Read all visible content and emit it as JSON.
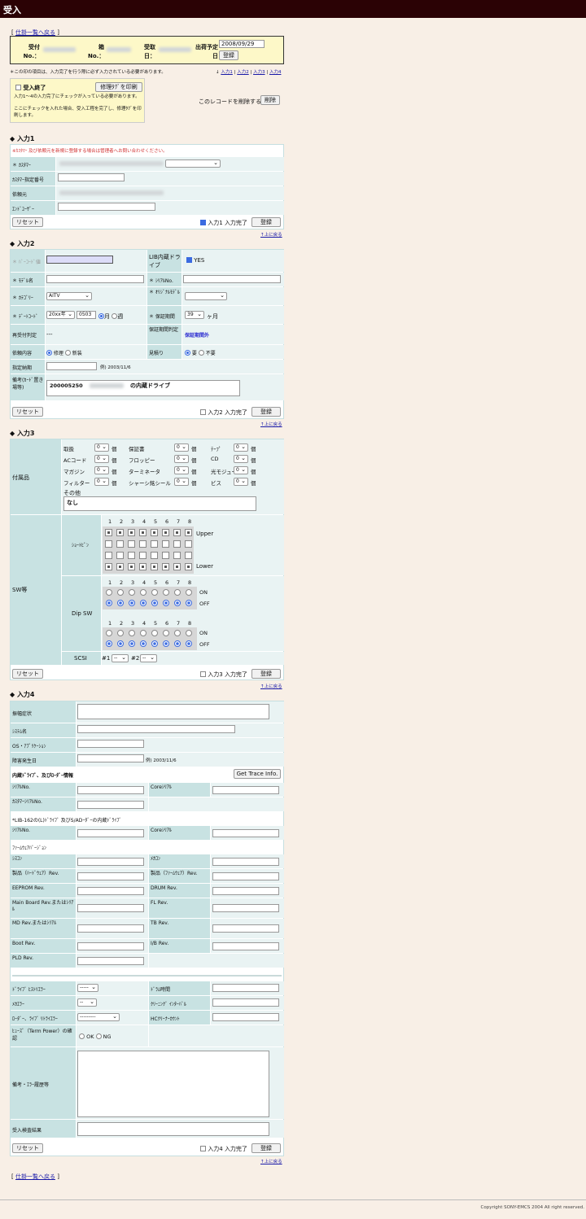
{
  "header": {
    "title": "受入"
  },
  "nav": {
    "back_link": "仕掛一覧へ戻る"
  },
  "summary": {
    "uketsuke_no": "受付No.：",
    "hako_no": "箱No.：",
    "uketori_date": "受取日：",
    "ship_date_label": "出荷予定日",
    "ship_date_value": "2008/09/29",
    "register": "登録"
  },
  "notice": "＊この印の項目は、入力完了を行う際に必ず入力されている必要があります。",
  "jump_links": {
    "arrow": "↓",
    "l1": "入力1",
    "l2": "入力2",
    "l3": "入力3",
    "l4": "入力4",
    "sep": "|"
  },
  "finish_box": {
    "checkbox_label": "受入終了",
    "print_button": "修理ﾀｸﾞを印刷",
    "line1": "入力1〜4の入力完了にチェックが入っている必要があります。",
    "line2": "ここにチェックを入れた場合、受入工程を完了し、修理ﾀｸﾞを印刷します。"
  },
  "delete_area": {
    "text": "このレコードを削除する",
    "button": "削除"
  },
  "common": {
    "reset": "リセット",
    "register": "登録",
    "to_top": "↑上に戻る",
    "done_suffix": "入力完了"
  },
  "section1": {
    "title": "◆ 入力1",
    "note": "※ｶｽﾀﾏｰ 及び依頼元を新規に登録する場合は管理者へお問い合わせください。",
    "customer": "＊ ｶｽﾀﾏｰ",
    "customer_no": "ｶｽﾀﾏｰ指定番号",
    "requester": "依頼元",
    "end_user": "ｴﾝﾄﾞﾕｰｻﾞｰ",
    "done": "入力1"
  },
  "section2": {
    "title": "◆ 入力2",
    "barcode": "＊ ﾊﾞｰｺｰﾄﾞ値",
    "lib": "LIB内蔵ドライブ",
    "lib_yes": "YES",
    "model": "＊ ﾓﾃﾞﾙ名",
    "serial": "＊ ｼﾘｱﾙNo.",
    "category": "＊ ｶﾃｺﾞﾘｰ",
    "category_value": "AITV",
    "orig_model": "＊ ｵﾘｼﾞﾅﾙﾓﾃﾞﾙ",
    "date_code": "＊ ﾃﾞｰﾄｺｰﾄﾞ",
    "year_value": "20xx年",
    "code_value": "0503",
    "month": "月",
    "week": "週",
    "warranty": "＊ 保証期間",
    "warranty_value": "39",
    "warranty_unit": "ヶ月",
    "re_receive": "再受付判定",
    "re_receive_value": "---",
    "warranty_judge": "保証期間判定",
    "warranty_judge_value": "保証期間外",
    "request": "依頼内容",
    "repair": "修理",
    "new": "新装",
    "estimate": "見積り",
    "need": "要",
    "no_need": "不要",
    "due": "指定納期",
    "due_example": "例) 2003/11/6",
    "remarks": "備考(ｶｰﾄﾞ置き場等)",
    "remarks_value": "200005250",
    "remarks_tail": "の内蔵ドライブ",
    "done": "入力2"
  },
  "section3": {
    "title": "◆ 入力3",
    "accessories": "付属品",
    "acc": [
      [
        "取扱",
        "0"
      ],
      [
        "保証書",
        "0"
      ],
      [
        "ﾃｰﾌﾟ",
        "0"
      ],
      [
        "ACコード",
        "0"
      ],
      [
        "フロッピー",
        "0"
      ],
      [
        "CD",
        "0"
      ],
      [
        "マガジン",
        "0"
      ],
      [
        "ターミネータ",
        "0"
      ],
      [
        "光モジュール",
        "0"
      ],
      [
        "フィルター",
        "0"
      ],
      [
        "シャーシ銘シール",
        "0"
      ],
      [
        "ビス",
        "0"
      ]
    ],
    "unit": "個",
    "other": "その他",
    "other_value": "なし",
    "sw": "SW等",
    "short_pin": "ｼｮｰﾄﾋﾟﾝ",
    "nums": [
      "1",
      "2",
      "3",
      "4",
      "5",
      "6",
      "7",
      "8"
    ],
    "upper": "Upper",
    "lower": "Lower",
    "dipsw": "Dip SW",
    "on": "ON",
    "off": "OFF",
    "scsi": "SCSI",
    "scsi1": "#1",
    "scsi2": "#2",
    "scsi_val": "--",
    "done": "入力3"
  },
  "section4": {
    "title": "◆ 入力4",
    "symptom": "振幅症状",
    "system": "ｼｽﾃﾑ名",
    "os": "OS・ｱﾌﾟﾘｹｰｼｮﾝ",
    "fault_date": "障害発生日",
    "fault_example": "例) 2003/11/6",
    "drive_info": "内蔵ﾄﾞﾗｲﾌﾞ、及びﾛｰﾀﾞｰ情報",
    "trace_button": "Get Trace Info.",
    "serial": "ｼﾘｱﾙNo.",
    "core_serial": "Coreｼﾘｱﾙ",
    "cust_serial": "ｶｽﾀﾏｰｼﾘｱﾙNo.",
    "lib162": "*LIB-162の(L)ﾄﾞﾗｲﾌﾞ 及びS/ADｰﾀﾞｰの内蔵ﾄﾞﾗｲﾌﾞ",
    "firmware": "ﾌｧｰﾑｳｪｱﾊﾞｰｼﾞｮﾝ",
    "syscon": "ｼｽｺﾝ",
    "mechacon": "ﾒｶｺﾝ",
    "hw_rev": "製品（ﾊｰﾄﾞｳｪｱ）Rev.",
    "fw_rev": "製品（ﾌｧｰﾑｳｪｱ）Rev.",
    "eeprom": "EEPROM Rev.",
    "drum": "DRUM Rev.",
    "mainboard": "Main Board Rev.またはｼﾘｱﾙ",
    "fl": "FL Rev.",
    "md": "MD Rev.またはｼﾘｱﾙ",
    "tb": "TB Rev.",
    "boot": "Boot Rev.",
    "ib": "I/B Rev.",
    "pld": "PLD Rev.",
    "drive_history": "ﾄﾞﾗｲﾌﾞ ﾋｽﾄﾘｴﾗｰ",
    "drive_history_val": "-----",
    "drum_time": "ﾄﾞﾗﾑ時間",
    "mecha_err": "ﾒｶｴﾗｰ",
    "mecha_err_val": "--",
    "cleaning": "ｸﾘｰﾆﾝｸﾞ ｲﾝﾀｰﾊﾞﾙ",
    "loader_err": "ﾛｰﾀﾞｰ、ﾗｲﾌﾞ ﾘﾄﾗｲｴﾗｰ",
    "loader_err_val": "---------",
    "hc_count": "HCｸﾘｰﾅｰｶｳﾝﾄ",
    "fuse": "ﾋｭｰｽﾞ（Term Power）の確認",
    "ok": "OK",
    "ng": "NG",
    "error_history": "備考・ｴﾗｰ履歴等",
    "inspection": "受入検査結果",
    "done": "入力4"
  },
  "footer": {
    "copyright": "Copyright SONY-EMCS 2004 All right reserved."
  },
  "colors": {
    "header_bar": "#2b0205",
    "label_bg": "#c8e2e2",
    "summary_bg": "#fdf8c8"
  }
}
